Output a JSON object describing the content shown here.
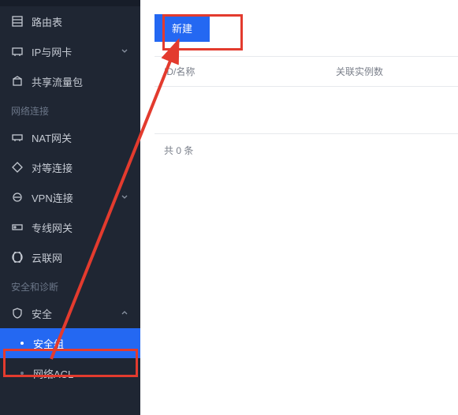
{
  "sidebar": {
    "top": [
      {
        "label": "路由表",
        "icon": "route-table-icon",
        "expandable": false
      },
      {
        "label": "IP与网卡",
        "icon": "ip-nic-icon",
        "expandable": true
      },
      {
        "label": "共享流量包",
        "icon": "traffic-package-icon",
        "expandable": false
      }
    ],
    "section_network_title": "网络连接",
    "network": [
      {
        "label": "NAT网关",
        "icon": "nat-gateway-icon"
      },
      {
        "label": "对等连接",
        "icon": "peering-icon"
      },
      {
        "label": "VPN连接",
        "icon": "vpn-icon",
        "expandable": true
      },
      {
        "label": "专线网关",
        "icon": "dedicated-line-icon"
      },
      {
        "label": "云联网",
        "icon": "cloud-net-icon"
      }
    ],
    "section_security_title": "安全和诊断",
    "security_parent": {
      "label": "安全",
      "icon": "shield-icon",
      "expanded": true
    },
    "security_children": [
      {
        "label": "安全组",
        "active": true
      },
      {
        "label": "网络ACL",
        "active": false
      }
    ]
  },
  "toolbar": {
    "new_label": "新建"
  },
  "table": {
    "col_id": "ID/名称",
    "col_rel": "关联实例数"
  },
  "footer": {
    "prefix": "共",
    "count": "0",
    "suffix": "条"
  },
  "colors": {
    "accent": "#2468f2",
    "annotation": "#e33b2e"
  }
}
